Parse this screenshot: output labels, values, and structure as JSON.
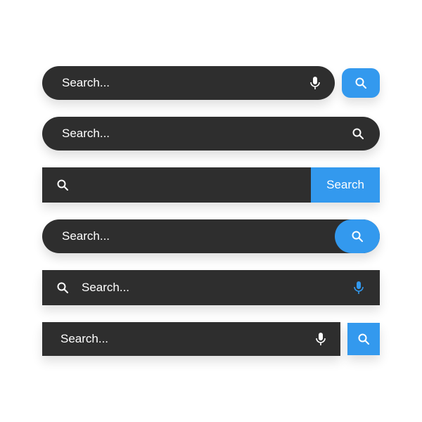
{
  "colors": {
    "dark": "#2e2e2e",
    "blue": "#3399ee",
    "white": "#ffffff"
  },
  "bars": {
    "b1": {
      "placeholder": "Search..."
    },
    "b2": {
      "placeholder": "Search..."
    },
    "b3": {
      "button_label": "Search"
    },
    "b4": {
      "placeholder": "Search..."
    },
    "b5": {
      "placeholder": "Search..."
    },
    "b6": {
      "placeholder": "Search..."
    }
  }
}
